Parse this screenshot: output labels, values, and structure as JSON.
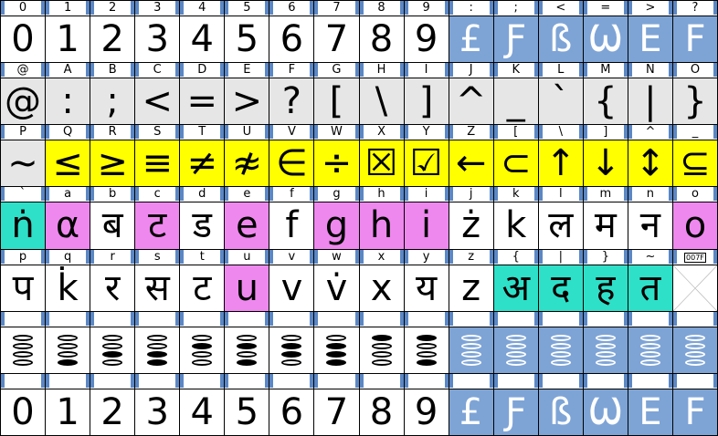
{
  "rows": [
    {
      "cells": [
        {
          "label": "0",
          "glyph": "0",
          "bg": "white"
        },
        {
          "label": "1",
          "glyph": "1",
          "bg": "white"
        },
        {
          "label": "2",
          "glyph": "2",
          "bg": "white"
        },
        {
          "label": "3",
          "glyph": "3",
          "bg": "white"
        },
        {
          "label": "4",
          "glyph": "4",
          "bg": "white"
        },
        {
          "label": "5",
          "glyph": "5",
          "bg": "white"
        },
        {
          "label": "6",
          "glyph": "6",
          "bg": "white"
        },
        {
          "label": "7",
          "glyph": "7",
          "bg": "white"
        },
        {
          "label": "8",
          "glyph": "8",
          "bg": "white"
        },
        {
          "label": "9",
          "glyph": "9",
          "bg": "white"
        },
        {
          "label": ":",
          "glyph": "£",
          "bg": "blue"
        },
        {
          "label": ";",
          "glyph": "Ƒ",
          "bg": "blue"
        },
        {
          "label": "<",
          "glyph": "ß",
          "bg": "blue"
        },
        {
          "label": "=",
          "glyph": "Ѡ",
          "bg": "blue"
        },
        {
          "label": ">",
          "glyph": "E",
          "bg": "blue"
        },
        {
          "label": "?",
          "glyph": "F",
          "bg": "blue"
        }
      ]
    },
    {
      "cells": [
        {
          "label": "@",
          "glyph": "@",
          "bg": "gray"
        },
        {
          "label": "A",
          "glyph": ":",
          "bg": "gray"
        },
        {
          "label": "B",
          "glyph": ";",
          "bg": "gray"
        },
        {
          "label": "C",
          "glyph": "<",
          "bg": "gray"
        },
        {
          "label": "D",
          "glyph": "=",
          "bg": "gray"
        },
        {
          "label": "E",
          "glyph": ">",
          "bg": "gray"
        },
        {
          "label": "F",
          "glyph": "?",
          "bg": "gray"
        },
        {
          "label": "G",
          "glyph": "[",
          "bg": "gray"
        },
        {
          "label": "H",
          "glyph": "\\",
          "bg": "gray"
        },
        {
          "label": "I",
          "glyph": "]",
          "bg": "gray"
        },
        {
          "label": "J",
          "glyph": "^",
          "bg": "gray"
        },
        {
          "label": "K",
          "glyph": "_",
          "bg": "gray"
        },
        {
          "label": "L",
          "glyph": "`",
          "bg": "gray"
        },
        {
          "label": "M",
          "glyph": "{",
          "bg": "gray"
        },
        {
          "label": "N",
          "glyph": "|",
          "bg": "gray"
        },
        {
          "label": "O",
          "glyph": "}",
          "bg": "gray"
        }
      ]
    },
    {
      "cells": [
        {
          "label": "P",
          "glyph": "~",
          "bg": "gray"
        },
        {
          "label": "Q",
          "glyph": "≤",
          "bg": "yellow"
        },
        {
          "label": "R",
          "glyph": "≥",
          "bg": "yellow"
        },
        {
          "label": "S",
          "glyph": "≡",
          "bg": "yellow"
        },
        {
          "label": "T",
          "glyph": "≠",
          "bg": "yellow"
        },
        {
          "label": "U",
          "glyph": "≉",
          "bg": "yellow"
        },
        {
          "label": "V",
          "glyph": "∈",
          "bg": "yellow"
        },
        {
          "label": "W",
          "glyph": "÷",
          "bg": "yellow"
        },
        {
          "label": "X",
          "glyph": "☒",
          "bg": "yellow"
        },
        {
          "label": "Y",
          "glyph": "☑",
          "bg": "yellow"
        },
        {
          "label": "Z",
          "glyph": "←",
          "bg": "yellow"
        },
        {
          "label": "[",
          "glyph": "⊂",
          "bg": "yellow"
        },
        {
          "label": "\\",
          "glyph": "↑",
          "bg": "yellow"
        },
        {
          "label": "]",
          "glyph": "↓",
          "bg": "yellow"
        },
        {
          "label": "^",
          "glyph": "↕",
          "bg": "yellow"
        },
        {
          "label": "_",
          "glyph": "⊆",
          "bg": "yellow"
        }
      ]
    },
    {
      "cells": [
        {
          "label": "`",
          "glyph": "ṅ",
          "bg": "cyan"
        },
        {
          "label": "a",
          "glyph": "α",
          "bg": "pink"
        },
        {
          "label": "b",
          "glyph": "ब",
          "bg": "white"
        },
        {
          "label": "c",
          "glyph": "ट",
          "bg": "pink"
        },
        {
          "label": "d",
          "glyph": "ड",
          "bg": "white"
        },
        {
          "label": "e",
          "glyph": "e",
          "bg": "pink"
        },
        {
          "label": "f",
          "glyph": "f",
          "bg": "white"
        },
        {
          "label": "g",
          "glyph": "g",
          "bg": "pink"
        },
        {
          "label": "h",
          "glyph": "h",
          "bg": "pink"
        },
        {
          "label": "i",
          "glyph": "i",
          "bg": "pink"
        },
        {
          "label": "j",
          "glyph": "ż",
          "bg": "white"
        },
        {
          "label": "k",
          "glyph": "k",
          "bg": "white"
        },
        {
          "label": "l",
          "glyph": "ल",
          "bg": "white"
        },
        {
          "label": "m",
          "glyph": "म",
          "bg": "white"
        },
        {
          "label": "n",
          "glyph": "न",
          "bg": "white"
        },
        {
          "label": "o",
          "glyph": "o",
          "bg": "pink"
        }
      ]
    },
    {
      "cells": [
        {
          "label": "p",
          "glyph": "प",
          "bg": "white"
        },
        {
          "label": "q",
          "glyph": "k̇",
          "bg": "white"
        },
        {
          "label": "r",
          "glyph": "र",
          "bg": "white"
        },
        {
          "label": "s",
          "glyph": "स",
          "bg": "white"
        },
        {
          "label": "t",
          "glyph": "ट",
          "bg": "white"
        },
        {
          "label": "u",
          "glyph": "u",
          "bg": "pink"
        },
        {
          "label": "v",
          "glyph": "v",
          "bg": "white"
        },
        {
          "label": "w",
          "glyph": "v̇",
          "bg": "white"
        },
        {
          "label": "x",
          "glyph": "x",
          "bg": "white"
        },
        {
          "label": "y",
          "glyph": "य",
          "bg": "white"
        },
        {
          "label": "z",
          "glyph": "z",
          "bg": "white"
        },
        {
          "label": "{",
          "glyph": "अ",
          "bg": "cyan"
        },
        {
          "label": "|",
          "glyph": "द",
          "bg": "cyan"
        },
        {
          "label": "}",
          "glyph": "ह",
          "bg": "cyan"
        },
        {
          "label": "~",
          "glyph": "त",
          "bg": "cyan"
        },
        {
          "label": "007F",
          "glyph": "",
          "bg": "white",
          "missing": true
        }
      ]
    },
    {
      "ovals": true,
      "cells": [
        {
          "label": "",
          "pattern": [
            0,
            0,
            0,
            0
          ],
          "bg": "white"
        },
        {
          "label": "",
          "pattern": [
            0,
            0,
            0,
            1
          ],
          "bg": "white"
        },
        {
          "label": "",
          "pattern": [
            0,
            0,
            1,
            0
          ],
          "bg": "white"
        },
        {
          "label": "",
          "pattern": [
            0,
            0,
            1,
            1
          ],
          "bg": "white"
        },
        {
          "label": "",
          "pattern": [
            0,
            1,
            0,
            0
          ],
          "bg": "white"
        },
        {
          "label": "",
          "pattern": [
            0,
            1,
            0,
            1
          ],
          "bg": "white"
        },
        {
          "label": "",
          "pattern": [
            0,
            1,
            1,
            0
          ],
          "bg": "white"
        },
        {
          "label": "",
          "pattern": [
            0,
            1,
            1,
            1
          ],
          "bg": "white"
        },
        {
          "label": "",
          "pattern": [
            1,
            0,
            0,
            0
          ],
          "bg": "white"
        },
        {
          "label": "",
          "pattern": [
            1,
            0,
            0,
            1
          ],
          "bg": "white"
        },
        {
          "label": "",
          "pattern": [
            0,
            0,
            0,
            0
          ],
          "bg": "blue"
        },
        {
          "label": "",
          "pattern": [
            0,
            0,
            0,
            0
          ],
          "bg": "blue"
        },
        {
          "label": "",
          "pattern": [
            0,
            0,
            0,
            0
          ],
          "bg": "blue"
        },
        {
          "label": "",
          "pattern": [
            0,
            0,
            0,
            0
          ],
          "bg": "blue"
        },
        {
          "label": "",
          "pattern": [
            0,
            0,
            0,
            0
          ],
          "bg": "blue"
        },
        {
          "label": "",
          "pattern": [
            0,
            0,
            0,
            0
          ],
          "bg": "blue"
        }
      ]
    },
    {
      "cells": [
        {
          "label": "",
          "glyph": "0",
          "bg": "white"
        },
        {
          "label": "",
          "glyph": "1",
          "bg": "white"
        },
        {
          "label": "",
          "glyph": "2",
          "bg": "white"
        },
        {
          "label": "",
          "glyph": "3",
          "bg": "white"
        },
        {
          "label": "",
          "glyph": "4",
          "bg": "white"
        },
        {
          "label": "",
          "glyph": "5",
          "bg": "white"
        },
        {
          "label": "",
          "glyph": "6",
          "bg": "white"
        },
        {
          "label": "",
          "glyph": "7",
          "bg": "white"
        },
        {
          "label": "",
          "glyph": "8",
          "bg": "white"
        },
        {
          "label": "",
          "glyph": "9",
          "bg": "white"
        },
        {
          "label": "",
          "glyph": "£",
          "bg": "blue"
        },
        {
          "label": "",
          "glyph": "Ƒ",
          "bg": "blue"
        },
        {
          "label": "",
          "glyph": "ß",
          "bg": "blue"
        },
        {
          "label": "",
          "glyph": "Ѡ",
          "bg": "blue"
        },
        {
          "label": "",
          "glyph": "E",
          "bg": "blue"
        },
        {
          "label": "",
          "glyph": "F",
          "bg": "blue"
        }
      ]
    }
  ]
}
